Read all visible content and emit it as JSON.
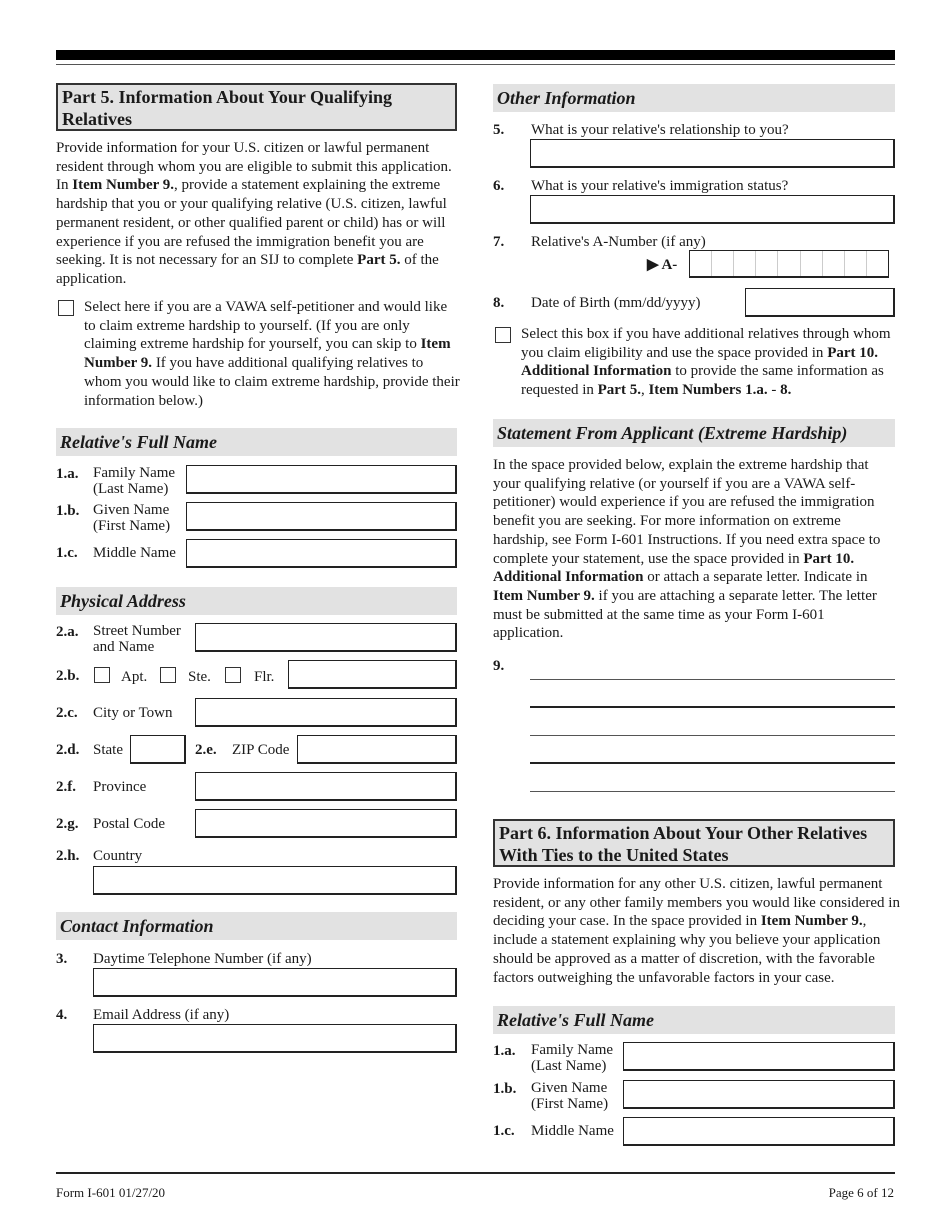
{
  "footer": {
    "form_id": "Form I-601   01/27/20",
    "page": "Page 6 of 12"
  },
  "part5": {
    "title": "Part 5.  Information About Your Qualifying Relatives",
    "intro": [
      {
        "t": "Provide information for your U.S. citizen or lawful permanent resident through whom you are eligible to submit this application.  In "
      },
      {
        "t": "Item Number 9.",
        "b": true
      },
      {
        "t": ", provide a statement explaining the extreme hardship that you or your qualifying relative (U.S. citizen, lawful permanent resident, or other qualified parent or child) has or will experience if you are refused the immigration benefit you are seeking.  It is not necessary for an SIJ to complete "
      },
      {
        "t": "Part 5.",
        "b": true
      },
      {
        "t": " of the application."
      }
    ],
    "vawa_checkbox": [
      {
        "t": "Select here if you are a VAWA self-petitioner and would like to claim extreme hardship to yourself.  (If you are only claiming extreme hardship for yourself, you can skip to "
      },
      {
        "t": "Item Number 9.",
        "b": true
      },
      {
        "t": "  If you have additional qualifying relatives to whom you would like to claim extreme hardship, provide their information below.)"
      }
    ],
    "name_section": {
      "title": "Relative's Full Name",
      "items": [
        {
          "num": "1.a.",
          "label": "Family Name (Last Name)",
          "value": ""
        },
        {
          "num": "1.b.",
          "label": "Given Name (First Name)",
          "value": ""
        },
        {
          "num": "1.c.",
          "label": "Middle Name",
          "value": ""
        }
      ]
    },
    "address_section": {
      "title": "Physical Address",
      "street": {
        "num": "2.a.",
        "label": "Street Number and Name",
        "value": ""
      },
      "unit": {
        "num": "2.b.",
        "options": [
          "Apt.",
          "Ste.",
          "Flr."
        ],
        "value": ""
      },
      "city": {
        "num": "2.c.",
        "label": "City or Town",
        "value": ""
      },
      "state": {
        "num": "2.d.",
        "label": "State",
        "value": ""
      },
      "zip": {
        "num": "2.e.",
        "label": "ZIP Code",
        "value": ""
      },
      "province": {
        "num": "2.f.",
        "label": "Province",
        "value": ""
      },
      "postal": {
        "num": "2.g.",
        "label": "Postal Code",
        "value": ""
      },
      "country": {
        "num": "2.h.",
        "label": "Country",
        "value": ""
      }
    },
    "contact_section": {
      "title": "Contact Information",
      "phone": {
        "num": "3.",
        "label": "Daytime Telephone Number (if any)",
        "value": ""
      },
      "email": {
        "num": "4.",
        "label": "Email Address (if any)",
        "value": ""
      }
    },
    "other_section": {
      "title": "Other Information",
      "relationship": {
        "num": "5.",
        "label": "What is your relative's relationship to you?",
        "value": ""
      },
      "status": {
        "num": "6.",
        "label": "What is your relative's immigration status?",
        "value": ""
      },
      "anumber": {
        "num": "7.",
        "label": "Relative's A-Number (if any)",
        "prefix": "▶ A-",
        "value": ""
      },
      "dob": {
        "num": "8.",
        "label": "Date of Birth (mm/dd/yyyy)",
        "value": ""
      },
      "additional_checkbox": [
        {
          "t": "Select this box if you have additional relatives through whom you claim eligibility and use the space provided in "
        },
        {
          "t": "Part 10. Additional Information",
          "b": true
        },
        {
          "t": " to provide the same information as requested in "
        },
        {
          "t": "Part 5.",
          "b": true
        },
        {
          "t": ", "
        },
        {
          "t": "Item Numbers 1.a.",
          "b": true
        },
        {
          "t": " - "
        },
        {
          "t": "8.",
          "b": true
        }
      ]
    },
    "statement_section": {
      "title": "Statement From Applicant (Extreme Hardship)",
      "body": [
        {
          "t": "In the space provided below, explain the extreme hardship that your qualifying relative (or yourself if you are a VAWA self-petitioner) would experience if you are refused the immigration benefit you are seeking.  For more information on extreme hardship, see Form I-601 Instructions.  If you need extra space to complete your statement, use the space provided in "
        },
        {
          "t": "Part 10. Additional Information",
          "b": true
        },
        {
          "t": " or attach a separate letter.  Indicate in "
        },
        {
          "t": "Item Number 9.",
          "b": true
        },
        {
          "t": " if you are attaching a separate letter.  The letter must be submitted at the same time as your Form I-601 application."
        }
      ],
      "item_num": "9.",
      "lines": [
        "",
        "",
        "",
        "",
        ""
      ]
    }
  },
  "part6": {
    "title": "Part 6.  Information About Your Other Relatives With Ties to the United States",
    "intro": [
      {
        "t": "Provide information for any other U.S. citizen, lawful permanent resident, or any other family members you would like considered in deciding your case.  In the space provided in "
      },
      {
        "t": "Item Number 9.",
        "b": true
      },
      {
        "t": ", include a statement explaining why you believe your application should be approved as a matter of discretion, with the favorable factors outweighing the unfavorable factors in your case."
      }
    ],
    "name_section": {
      "title": "Relative's Full Name",
      "items": [
        {
          "num": "1.a.",
          "label": "Family Name (Last Name)",
          "value": ""
        },
        {
          "num": "1.b.",
          "label": "Given Name (First Name)",
          "value": ""
        },
        {
          "num": "1.c.",
          "label": "Middle Name",
          "value": ""
        }
      ]
    }
  }
}
